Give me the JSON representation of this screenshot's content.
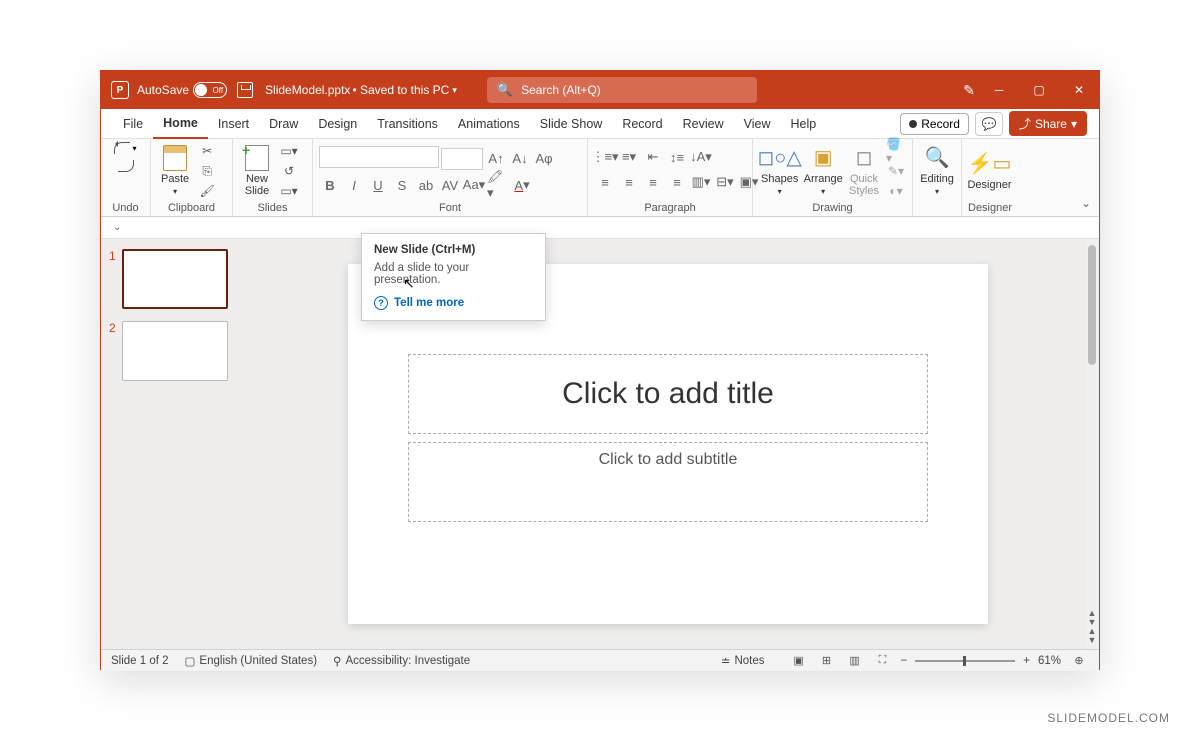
{
  "titlebar": {
    "autosave_label": "AutoSave",
    "autosave_state": "Off",
    "filename": "SlideModel.pptx",
    "saved_status": "• Saved to this PC",
    "search_placeholder": "Search (Alt+Q)"
  },
  "menu": {
    "tabs": [
      "File",
      "Home",
      "Insert",
      "Draw",
      "Design",
      "Transitions",
      "Animations",
      "Slide Show",
      "Record",
      "Review",
      "View",
      "Help"
    ],
    "active_tab": "Home",
    "record_label": "Record",
    "share_label": "Share"
  },
  "ribbon": {
    "undo_label": "Undo",
    "clipboard_label": "Clipboard",
    "paste_label": "Paste",
    "newslide_label": "New\nSlide",
    "slides_label": "Slides",
    "font_label": "Font",
    "paragraph_label": "Paragraph",
    "shapes_label": "Shapes",
    "arrange_label": "Arrange",
    "quickstyles_label": "Quick\nStyles",
    "drawing_label": "Drawing",
    "editing_label": "Editing",
    "designer_label": "Designer",
    "designer_group": "Designer"
  },
  "tooltip": {
    "title": "New Slide (Ctrl+M)",
    "desc": "Add a slide to your presentation.",
    "link": "Tell me more"
  },
  "thumbs": {
    "n1": "1",
    "n2": "2"
  },
  "slide": {
    "title_placeholder": "Click to add title",
    "subtitle_placeholder": "Click to add subtitle"
  },
  "status": {
    "slide_info": "Slide 1 of 2",
    "language": "English (United States)",
    "accessibility": "Accessibility: Investigate",
    "notes_label": "Notes",
    "zoom": "61%"
  },
  "watermark": "SLIDEMODEL.COM"
}
